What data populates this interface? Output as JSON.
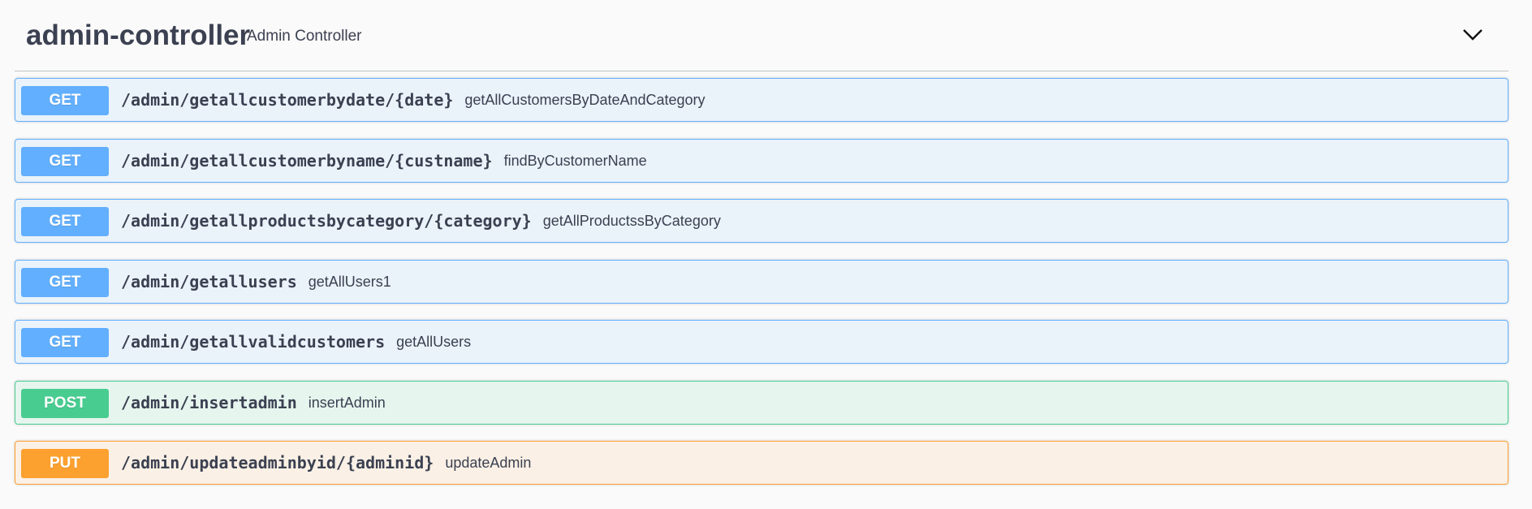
{
  "tag": {
    "name": "admin-controller",
    "description": "Admin Controller"
  },
  "operations": [
    {
      "method": "GET",
      "path": "/admin/getallcustomerbydate/{date}",
      "summary": "getAllCustomersByDateAndCategory"
    },
    {
      "method": "GET",
      "path": "/admin/getallcustomerbyname/{custname}",
      "summary": "findByCustomerName"
    },
    {
      "method": "GET",
      "path": "/admin/getallproductsbycategory/{category}",
      "summary": "getAllProductssByCategory"
    },
    {
      "method": "GET",
      "path": "/admin/getallusers",
      "summary": "getAllUsers1"
    },
    {
      "method": "GET",
      "path": "/admin/getallvalidcustomers",
      "summary": "getAllUsers"
    },
    {
      "method": "POST",
      "path": "/admin/insertadmin",
      "summary": "insertAdmin"
    },
    {
      "method": "PUT",
      "path": "/admin/updateadminbyid/{adminid}",
      "summary": "updateAdmin"
    }
  ],
  "colors": {
    "get": "#61affe",
    "post": "#49cc90",
    "put": "#fca130",
    "text": "#3b4151"
  },
  "icons": {
    "collapse": "chevron-down-icon"
  }
}
